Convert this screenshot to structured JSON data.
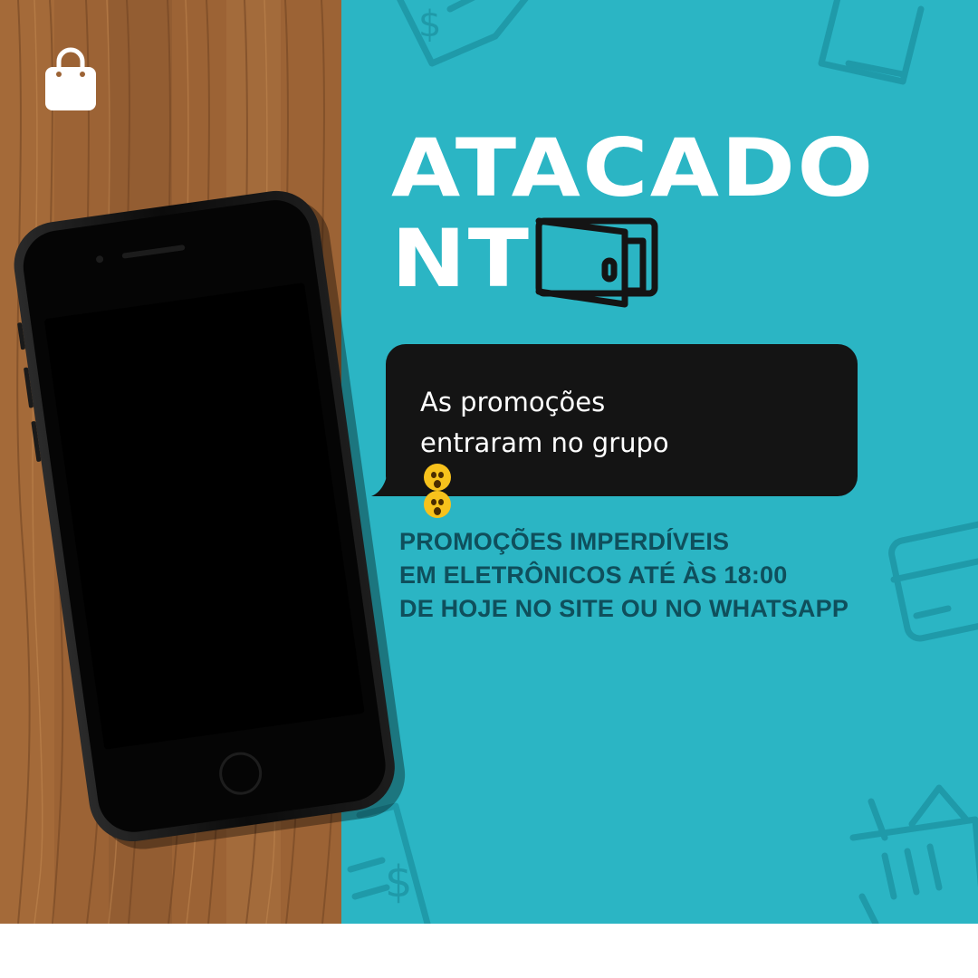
{
  "brand": {
    "line1": "ATACADO",
    "line2": "NT",
    "wallet_icon": "wallet-icon"
  },
  "bubble": {
    "line1": "As promoções",
    "line2": "entraram no grupo",
    "emoji": "astonished-face-emoji"
  },
  "promo": {
    "line1": "PROMOÇÕES IMPERDÍVEIS",
    "line2": "EM ELETRÔNICOS ATÉ ÀS 18:00",
    "line3": "DE HOJE NO SITE OU NO WHATSAPP"
  },
  "icons": [
    "shopping-bag-icon",
    "wallet-icon",
    "receipt-icon",
    "credit-card-icon",
    "shopping-basket-icon"
  ],
  "colors": {
    "teal": "#2bb5c4",
    "wood": "#9a6236",
    "bubble": "#141414",
    "promo_text": "#0f4f5c",
    "white": "#ffffff"
  }
}
